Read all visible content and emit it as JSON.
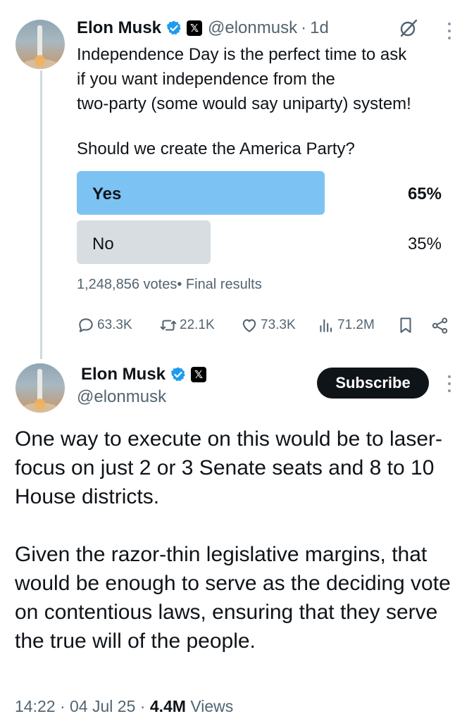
{
  "first_tweet": {
    "author_name": "Elon Musk",
    "handle": "@elonmusk",
    "separator": "·",
    "time": "1d",
    "x_badge": "𝕏",
    "text_lines": [
      "Independence Day is the perfect time to ask",
      "if you want independence from the",
      "two-party (some would say uniparty) system!"
    ],
    "poll": {
      "question": "Should we create the America Party?",
      "options": [
        {
          "label": "Yes",
          "percent": "65%",
          "fraction": 0.65,
          "bar_color": "#7cc3f3"
        },
        {
          "label": "No",
          "percent": "35%",
          "fraction": 0.35,
          "bar_color": "#d7dde1"
        }
      ],
      "votes": "1,248,856 votes",
      "status": "• Final results"
    },
    "actions": {
      "replies": "63.3K",
      "reposts": "22.1K",
      "likes": "73.3K",
      "views": "71.2M"
    }
  },
  "second_tweet": {
    "author_name": "Elon Musk",
    "handle": "@elonmusk",
    "x_badge": "𝕏",
    "subscribe_label": "Subscribe",
    "paragraphs": [
      "One way to execute on this would be to laser-focus on just 2 or 3 Senate seats and 8 to 10 House districts.",
      "Given the razor-thin legislative margins, that would be enough to serve as the deciding vote on contentious laws, ensuring that they serve the true will of the people."
    ],
    "footer": {
      "time": "14:22",
      "date": "04 Jul 25",
      "views_count": "4.4M",
      "views_label": "Views",
      "separator": "·"
    }
  },
  "icons": {
    "verified": "verified-badge-icon",
    "x_badge": "x-logo-icon",
    "grok": "grok-icon",
    "more": "more-options-icon",
    "reply": "reply-icon",
    "repost": "repost-icon",
    "like": "heart-icon",
    "views": "views-icon",
    "bookmark": "bookmark-icon",
    "share": "share-icon"
  },
  "colors": {
    "accent": "#1d9bf0",
    "poll_winner": "#7cc3f3",
    "poll_loser": "#d7dde1",
    "secondary_text": "#536471"
  }
}
